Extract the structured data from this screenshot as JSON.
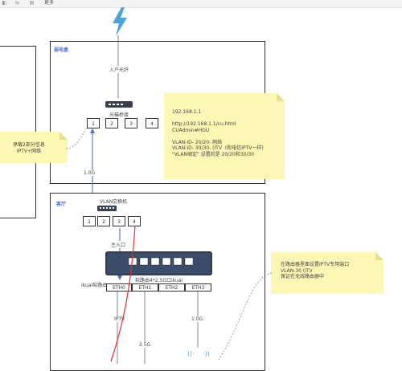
{
  "toolbar": {
    "more_label": "更多",
    "icons": [
      "undo-icon",
      "redo-icon",
      "format-icon"
    ]
  },
  "weak_box": {
    "title": "弱电盒",
    "fiber_label": "入户光纤",
    "modem_label": "光猫桥接",
    "ports": [
      "1",
      "2",
      "3",
      "4"
    ]
  },
  "note_modem": {
    "lines": [
      "192.168.1.1",
      "",
      "http://192.168.1.1/cu.html",
      "CUAdmin#HGU",
      "",
      "VLAN-ID- 20/20- 网络",
      "VLAN-ID- 30/30- (ITV  (和电信IPTV一样)",
      "\"VLAN绑定\" 设置的是 20/20和30/30"
    ]
  },
  "note_left": {
    "lines": [
      "承载2部分信息",
      "IPTV+网络"
    ]
  },
  "link_speed_top": "1.0G",
  "living_box": {
    "title": "客厅",
    "switch_label": "VLAN交换机",
    "switch_ports": [
      "1",
      "2",
      "3",
      "4"
    ],
    "main_in_label": "主入口",
    "router_label": "软路由4*2.5G口ikuai",
    "router_side_label": "ikuai软路由",
    "eth_ports": [
      "ETH0",
      "ETH1",
      "ETH2",
      "ETH3"
    ],
    "iptv_label": "IPTV",
    "speed_25": "2.5G",
    "speed_10": "1.0G"
  },
  "note_right": {
    "lines": [
      "在路由器里面设置IPTV专用端口",
      "VLAN-30 (ITV",
      "保证在无线路由器中"
    ]
  },
  "colors": {
    "note": "#fdf7b6",
    "panel_title": "#4a6fd1",
    "link_blue": "#4a6fd1",
    "link_red": "#e03030",
    "bolt": "#4fa3d8",
    "router": "#2f3e55"
  }
}
